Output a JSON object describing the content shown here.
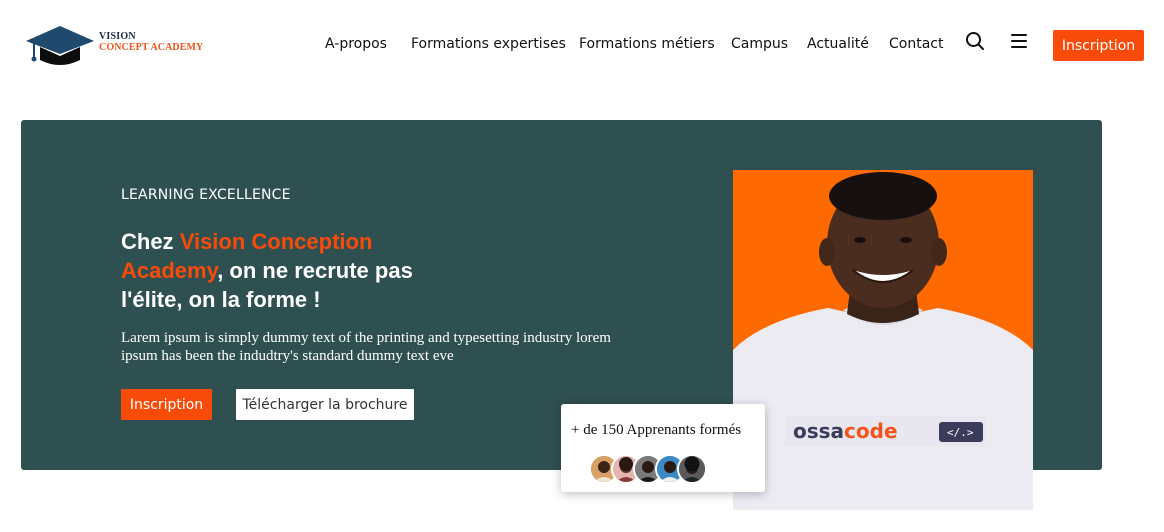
{
  "brand": {
    "line1": "VISION",
    "line2": "CONCEPT ACADEMY",
    "logo_icon": "graduation-cap-icon",
    "colors": {
      "navy": "#1d2a4a",
      "accent": "#f2541b"
    }
  },
  "nav": {
    "items": [
      "A-propos",
      "Formations expertises",
      "Formations métiers",
      "Campus",
      "Actualité",
      "Contact"
    ],
    "search_icon": "search-icon",
    "menu_icon": "hamburger-menu-icon",
    "cta_label": "Inscription"
  },
  "hero": {
    "background_color": "#2f5050",
    "accent_color": "#f84b09",
    "eyebrow": "LEARNING EXCELLENCE",
    "headline_before": "Chez ",
    "headline_accent": "Vision Conception Academy",
    "headline_after": ", on ne recrute pas l'élite, on la forme !",
    "description": "Larem ipsum is simply dummy text of the printing and typesetting industry lorem ipsum has been the indudtry's standard dummy text eve",
    "primary_button": "Inscription",
    "secondary_button": "Télécharger la brochure",
    "photo": {
      "background_color": "#ff6a00",
      "shirt_text_a": "ossa",
      "shirt_text_b": "code",
      "shirt_tag": "</.>"
    },
    "stats_card": {
      "text": "+ de 150 Apprenants formés",
      "avatar_count": 5
    }
  }
}
